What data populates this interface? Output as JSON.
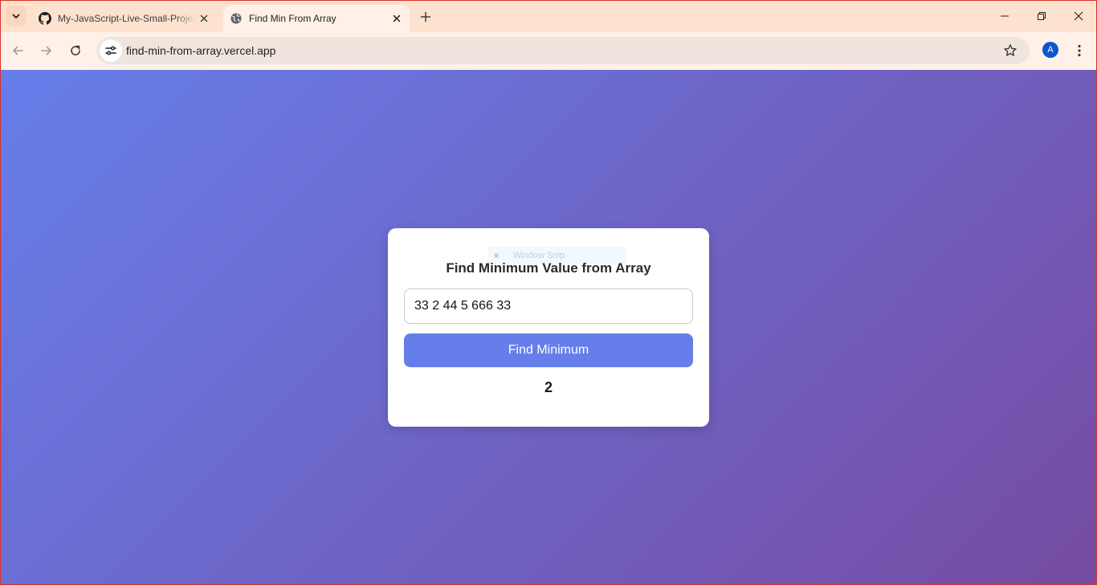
{
  "browser": {
    "tabs": [
      {
        "title": "My-JavaScript-Live-Small-Projects",
        "active": false
      },
      {
        "title": "Find Min From Array",
        "active": true
      }
    ],
    "url": "find-min-from-array.vercel.app",
    "profile_initial": "A",
    "colors": {
      "tabstrip": "#fde3cf",
      "toolbar": "#fff1e8",
      "avatar": "#0b57d0"
    }
  },
  "overlay": {
    "label": "Window Snip"
  },
  "app": {
    "title": "Find Minimum Value from Array",
    "input_value": "33 2 44 5 666 33",
    "button_label": "Find Minimum",
    "result": "2",
    "colors": {
      "gradient_start": "#667eea",
      "gradient_end": "#764ba2",
      "button": "#667eea"
    }
  }
}
